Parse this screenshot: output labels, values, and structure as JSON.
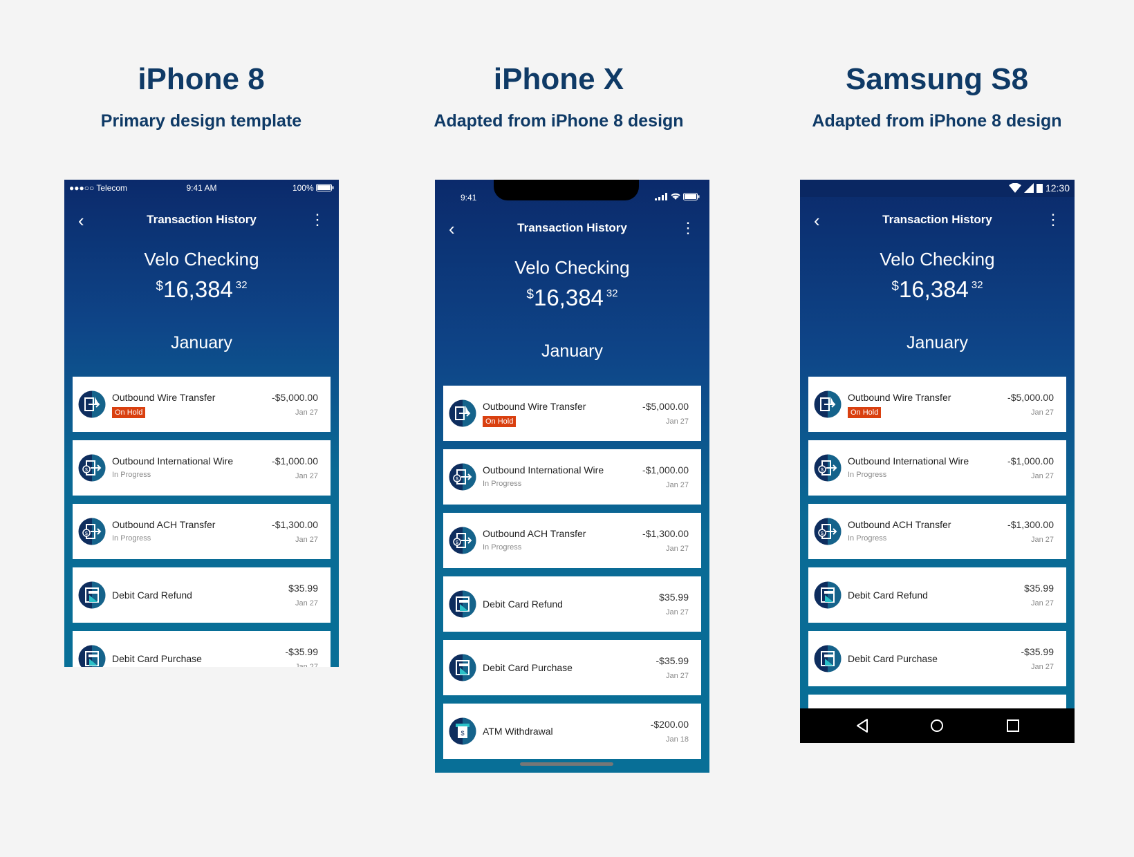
{
  "columns": [
    {
      "device": "iPhone 8",
      "subtitle": "Primary design template"
    },
    {
      "device": "iPhone X",
      "subtitle": "Adapted from iPhone 8 design"
    },
    {
      "device": "Samsung S8",
      "subtitle": "Adapted from iPhone 8 design"
    }
  ],
  "iphone8_status": {
    "carrier": "●●●○○ Telecom",
    "time": "9:41 AM",
    "battery": "100%"
  },
  "iphonex_status": {
    "time": "9:41"
  },
  "s8_status": {
    "time": "12:30"
  },
  "screen": {
    "title": "Transaction History",
    "back_icon": "‹",
    "more_icon": "⋮",
    "account_name": "Velo Checking",
    "currency": "$",
    "balance_whole": "16,384",
    "balance_cents": "32",
    "month": "January"
  },
  "transactions": [
    {
      "name": "Outbound Wire Transfer",
      "status": "On Hold",
      "amount": "-$5,000.00",
      "date": "Jan 27",
      "icon": "wire-transfer-icon"
    },
    {
      "name": "Outbound International Wire",
      "status": "In Progress",
      "amount": "-$1,000.00",
      "date": "Jan 27",
      "icon": "international-wire-icon"
    },
    {
      "name": "Outbound ACH Transfer",
      "status": "In Progress",
      "amount": "-$1,300.00",
      "date": "Jan 27",
      "icon": "ach-transfer-icon"
    },
    {
      "name": "Debit Card Refund",
      "status": "",
      "amount": "$35.99",
      "date": "Jan 27",
      "icon": "debit-card-icon"
    },
    {
      "name": "Debit Card Purchase",
      "status": "",
      "amount": "-$35.99",
      "date": "Jan 27",
      "icon": "debit-card-icon"
    },
    {
      "name": "ATM Withdrawal",
      "status": "",
      "amount": "-$200.00",
      "date": "Jan 18",
      "icon": "atm-icon"
    }
  ],
  "colors": {
    "hold_badge": "#d94010",
    "heading": "#0f3a66",
    "gradient_top": "#0b2a6b",
    "gradient_bottom": "#086f97"
  }
}
